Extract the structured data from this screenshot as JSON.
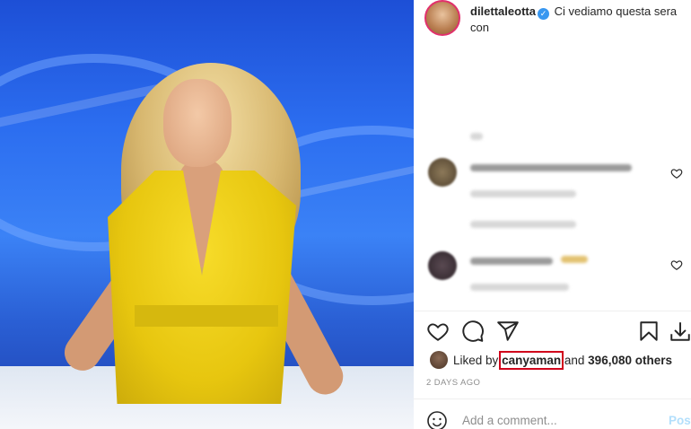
{
  "post": {
    "username": "dilettaleotta",
    "caption": "Ci vediamo questa sera con",
    "verified_icon": "verified-badge-icon"
  },
  "likes": {
    "prefix": "Liked by",
    "liker": "canyaman",
    "middle": "and",
    "count": "396,080 others"
  },
  "time_ago": "2 DAYS AGO",
  "comment_box": {
    "placeholder": "Add a comment...",
    "post_label": "Post"
  },
  "actions": [
    "heart-icon",
    "comment-icon",
    "share-icon",
    "bookmark-icon",
    "download-icon"
  ],
  "colors": {
    "highlight": "#d0021b",
    "verified": "#3897f0",
    "post_button": "#b2dffc"
  }
}
